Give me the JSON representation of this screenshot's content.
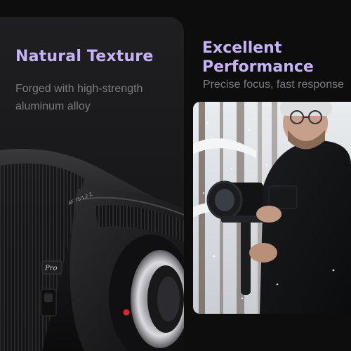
{
  "left_card": {
    "title": "Natural Texture",
    "subtitle": "Forged with high-strength aluminum alloy",
    "image": {
      "icon": "camera-lens-icon",
      "engraving": "AF 75/1.2 Z",
      "badge": "Pro"
    }
  },
  "right_card": {
    "title": "Excellent Performance",
    "subtitle": "Precise focus, fast response",
    "image": {
      "icon": "photographer-with-gimbal-image"
    }
  },
  "colors": {
    "accent": "#c6b3f3",
    "subtext": "#7b7b7f",
    "background": "#0d0d0e",
    "card": "#1c1c1e",
    "lens_red_dot": "#e0242b"
  }
}
